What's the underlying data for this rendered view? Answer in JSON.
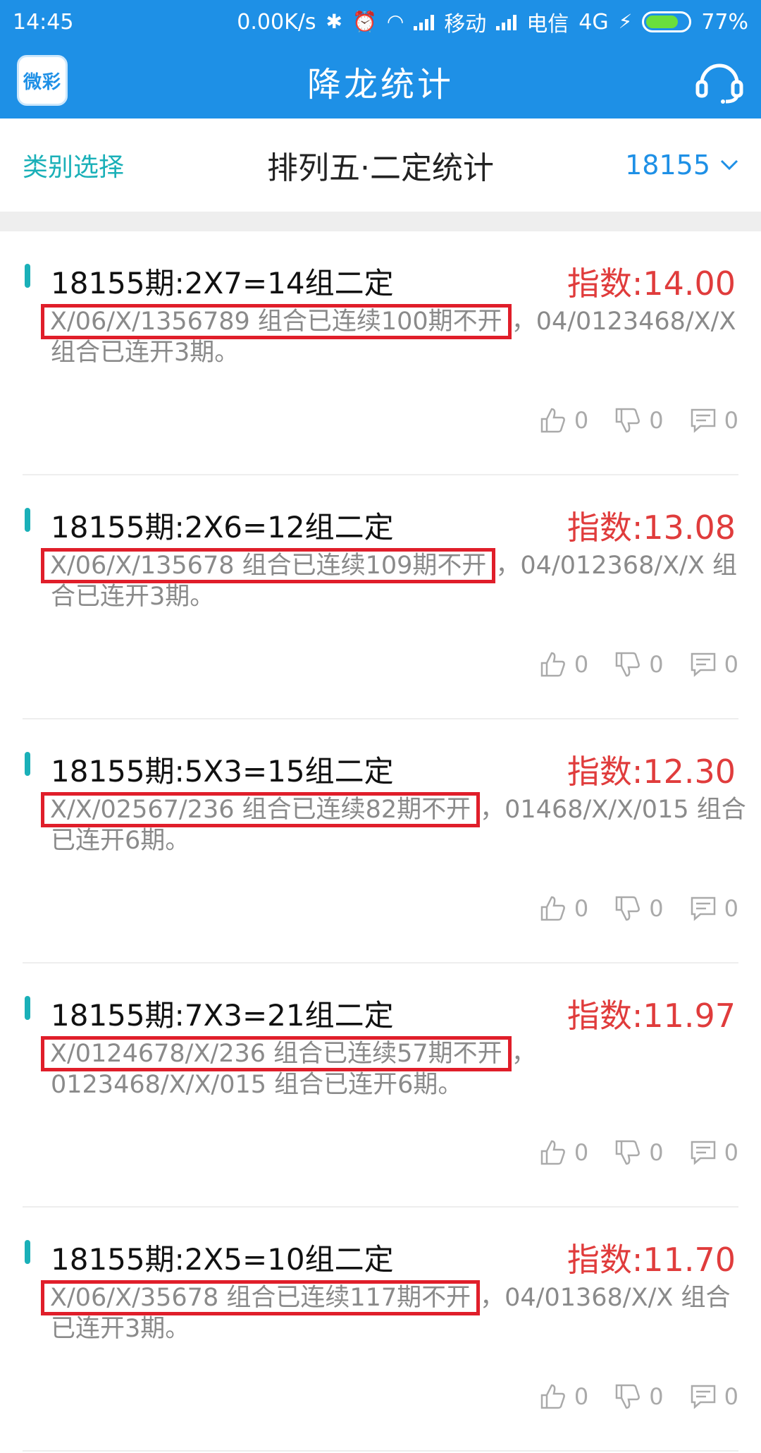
{
  "status_bar": {
    "time": "14:45",
    "speed": "0.00K/s",
    "carrier1": "移动",
    "carrier2": "电信",
    "network": "4G",
    "battery": "77%",
    "battery_level": 0.77
  },
  "app_bar": {
    "logo_text": "微彩",
    "title": "降龙统计",
    "support_icon": "headset-icon"
  },
  "tabs": {
    "left": "类别选择",
    "center": "排列五·二定统计",
    "right": "18155"
  },
  "items": [
    {
      "title": "18155期:2X7=14组二定",
      "index": "指数:14.00",
      "highlight": "X/06/X/1356789 组合已连续100期不开",
      "rest": "，04/0123468/X/X 组合已连开3期。",
      "likes": "0",
      "dislikes": "0",
      "comments": "0"
    },
    {
      "title": "18155期:2X6=12组二定",
      "index": "指数:13.08",
      "highlight": "X/06/X/135678 组合已连续109期不开",
      "rest": "，04/012368/X/X 组合已连开3期。",
      "likes": "0",
      "dislikes": "0",
      "comments": "0"
    },
    {
      "title": "18155期:5X3=15组二定",
      "index": "指数:12.30",
      "highlight": "X/X/02567/236 组合已连续82期不开",
      "rest": "，01468/X/X/015 组合已连开6期。",
      "likes": "0",
      "dislikes": "0",
      "comments": "0"
    },
    {
      "title": "18155期:7X3=21组二定",
      "index": "指数:11.97",
      "highlight": "X/0124678/X/236 组合已连续57期不开",
      "rest": "，0123468/X/X/015 组合已连开6期。",
      "likes": "0",
      "dislikes": "0",
      "comments": "0"
    },
    {
      "title": "18155期:2X5=10组二定",
      "index": "指数:11.70",
      "highlight": "X/06/X/35678 组合已连续117期不开",
      "rest": "，04/01368/X/X 组合已连开3期。",
      "likes": "0",
      "dislikes": "0",
      "comments": "0"
    }
  ],
  "colors": {
    "primary": "#1e90e6",
    "teal": "#1ab0b8",
    "index_red": "#e03c3c",
    "highlight_red": "#e01e2a"
  }
}
